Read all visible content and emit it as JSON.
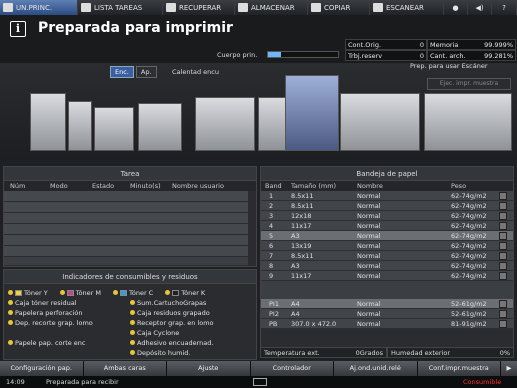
{
  "tabs": [
    {
      "label": "UN.PRINC.",
      "active": true
    },
    {
      "label": "LISTA TAREAS",
      "active": false
    },
    {
      "label": "RECUPERAR",
      "active": false
    },
    {
      "label": "ALMACENAR",
      "active": false
    },
    {
      "label": "COPIAR",
      "active": false
    },
    {
      "label": "ESCANEAR",
      "active": false
    }
  ],
  "header": {
    "title": "Preparada para imprimir",
    "cuerpo_label": "Cuerpo prin.",
    "cuerpo_progress": 0.18,
    "cont_orig_label": "Cont.Orig.",
    "cont_orig_value": "0",
    "memoria_label": "Memoria",
    "memoria_value": "99.999%",
    "trbj_label": "Trbj.reserv",
    "trbj_value": "0",
    "cant_label": "Cant. arch.",
    "cant_value": "99.281%"
  },
  "machine": {
    "enc_label": "Enc.",
    "ap_label": "Ap.",
    "calent_label": "Calentad encu",
    "prep_escaner": "Prep. para usar Escáner",
    "ejec_label": "Ejec. impr. muestra"
  },
  "tarea": {
    "title": "Tarea",
    "columns": [
      "Núm",
      "Modo",
      "Estado",
      "Minuto(s)",
      "Nombre usuario"
    ]
  },
  "consumables": {
    "title": "Indicadores de consumibles y residuos",
    "items": [
      "Tóner Y",
      "Tóner M",
      "Tóner C",
      "Tóner K",
      "Caja tóner residual",
      "Sum.CartuchoGrapas",
      "Papelera perforación",
      "Caja residuos grapado",
      "Dep. recorte grap. lomo",
      "Receptor grap. en lomo",
      "Caja Cyclone",
      "Papele pap. corte enc",
      "Adhesivo encuadernad.",
      "Depósito humid."
    ]
  },
  "bandeja": {
    "title": "Bandeja de papel",
    "columns": [
      "Band",
      "Tamaño (mm)",
      "Nombre",
      "Peso"
    ],
    "rows": [
      {
        "band": "1",
        "size": "8.5x11",
        "name": "Normal",
        "weight": "62-74g/m2"
      },
      {
        "band": "2",
        "size": "8.5x11",
        "name": "Normal",
        "weight": "62-74g/m2"
      },
      {
        "band": "3",
        "size": "12x18",
        "name": "Normal",
        "weight": "62-74g/m2"
      },
      {
        "band": "4",
        "size": "11x17",
        "name": "Normal",
        "weight": "62-74g/m2"
      },
      {
        "band": "5",
        "size": "A3",
        "name": "Normal",
        "weight": "62-74g/m2"
      },
      {
        "band": "6",
        "size": "13x19",
        "name": "Normal",
        "weight": "62-74g/m2"
      },
      {
        "band": "7",
        "size": "8.5x11",
        "name": "Normal",
        "weight": "62-74g/m2"
      },
      {
        "band": "8",
        "size": "A3",
        "name": "Normal",
        "weight": "62-74g/m2"
      },
      {
        "band": "9",
        "size": "11x17",
        "name": "Normal",
        "weight": "62-74g/m2"
      },
      {
        "band": "PI1",
        "size": "A4",
        "name": "Normal",
        "weight": "52-61g/m2"
      },
      {
        "band": "PI2",
        "size": "A4",
        "name": "Normal",
        "weight": "52-61g/m2"
      },
      {
        "band": "PB",
        "size": "307.0 x 472.0",
        "name": "Normal",
        "weight": "81-91g/m2"
      }
    ],
    "temp_label": "Temperatura ext.",
    "temp_value": "0Grados",
    "hum_label": "Humedad exterior",
    "hum_value": "0%"
  },
  "buttons": [
    "Configuración pap.",
    "Ambas caras",
    "Ajuste",
    "Controlador",
    "Aj.ond.unid.relé",
    "Conf.impr.muestra"
  ],
  "status": {
    "clock": "14:09",
    "message": "Preparada para recibir",
    "consumible": "Consumible"
  },
  "colors": {
    "accent": "#3b5fa0",
    "warn": "#ff3030"
  }
}
